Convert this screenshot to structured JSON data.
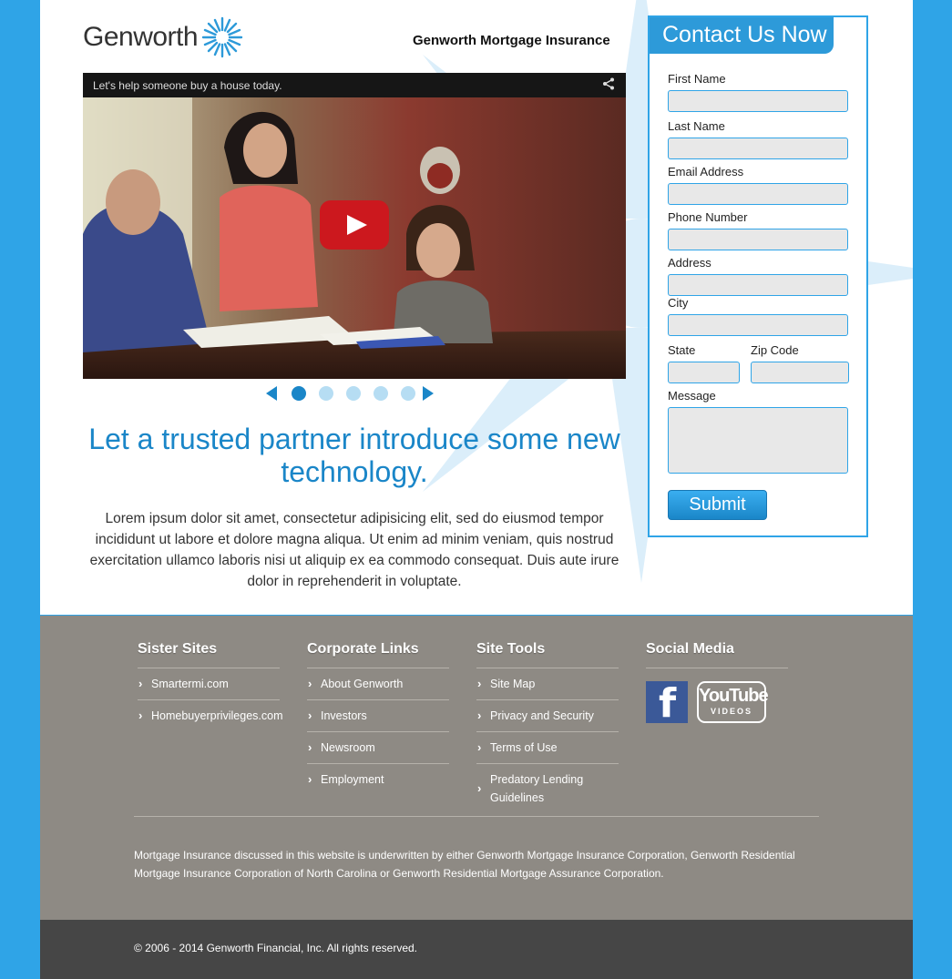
{
  "header": {
    "logo_text": "Genworth",
    "site_title": "Genworth Mortgage Insurance"
  },
  "video": {
    "caption": "Let's help someone buy a house today.",
    "share_icon": "share-icon",
    "play_icon": "play-icon"
  },
  "carousel": {
    "slides": 5,
    "active_index": 0
  },
  "main": {
    "headline": "Let a trusted partner introduce some new technology.",
    "body": "Lorem ipsum dolor sit amet, consectetur adipisicing elit, sed do eiusmod tempor incididunt ut labore et dolore magna aliqua. Ut enim ad minim veniam, quis nostrud exercitation ullamco laboris nisi ut aliquip ex ea commodo consequat. Duis aute irure dolor in reprehenderit in voluptate."
  },
  "contact": {
    "title": "Contact Us Now",
    "first_name": "First Name",
    "last_name": "Last Name",
    "email": "Email Address",
    "phone": "Phone Number",
    "address": "Address",
    "city": "City",
    "state": "State",
    "zip": "Zip Code",
    "message": "Message",
    "submit": "Submit"
  },
  "footer": {
    "sister_sites": {
      "title": "Sister Sites",
      "items": [
        "Smartermi.com",
        "Homebuyerprivileges.com"
      ]
    },
    "corporate_links": {
      "title": "Corporate Links",
      "items": [
        "About Genworth",
        "Investors",
        "Newsroom",
        "Employment"
      ]
    },
    "site_tools": {
      "title": "Site Tools",
      "items": [
        "Site Map",
        "Privacy and Security",
        "Terms of Use",
        "Predatory Lending Guidelines"
      ]
    },
    "social_media": {
      "title": "Social Media",
      "facebook_glyph": "f",
      "youtube_main": "YouTube",
      "youtube_sub": "VIDEOS"
    },
    "disclaimer": "Mortgage Insurance discussed in this website is underwritten by either Genworth Mortgage Insurance Corporation, Genworth Residential Mortgage Insurance Corporation of North Carolina or Genworth Residential Mortgage Assurance Corporation.",
    "copyright": "© 2006 - 2014 Genworth Financial, Inc. All rights reserved."
  },
  "colors": {
    "brand_blue": "#2fa4e7",
    "headline_blue": "#1a86c8",
    "footer_gray": "#8e8a84",
    "copyright_gray": "#464646"
  }
}
